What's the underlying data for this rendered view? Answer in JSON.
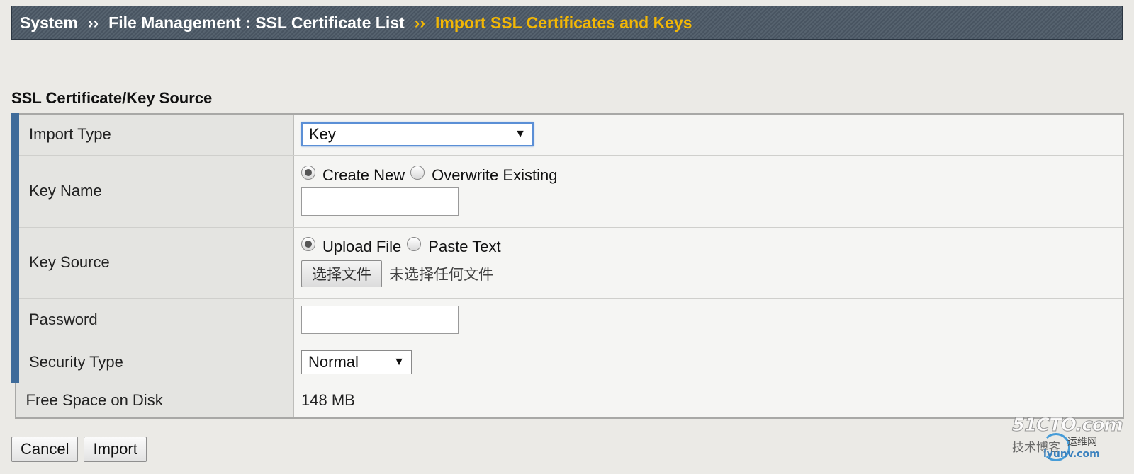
{
  "breadcrumb": {
    "items": [
      "System",
      "File Management : SSL Certificate List",
      "Import SSL Certificates and Keys"
    ],
    "separator": "››",
    "active_color": "#f2b705"
  },
  "section": {
    "title": "SSL Certificate/Key Source"
  },
  "form": {
    "import_type": {
      "label": "Import Type",
      "value": "Key"
    },
    "key_name": {
      "label": "Key Name",
      "option_create": "Create New",
      "option_overwrite": "Overwrite Existing",
      "selected": "Create New",
      "value": ""
    },
    "key_source": {
      "label": "Key Source",
      "option_upload": "Upload File",
      "option_paste": "Paste Text",
      "selected": "Upload File",
      "file_button": "选择文件",
      "file_status": "未选择任何文件"
    },
    "password": {
      "label": "Password",
      "value": ""
    },
    "security_type": {
      "label": "Security Type",
      "value": "Normal"
    },
    "free_space": {
      "label": "Free Space on Disk",
      "value": "148 MB"
    }
  },
  "actions": {
    "cancel": "Cancel",
    "import": "Import"
  },
  "watermark": {
    "brand": "51CTO.com",
    "tagline": "技术博客",
    "partner": "运维网",
    "url": "iyunv.com"
  },
  "icons": {
    "caret": "caret-down-icon"
  },
  "colors": {
    "required_bar": "#3e6b9a",
    "header_bg": "#4c5966"
  }
}
